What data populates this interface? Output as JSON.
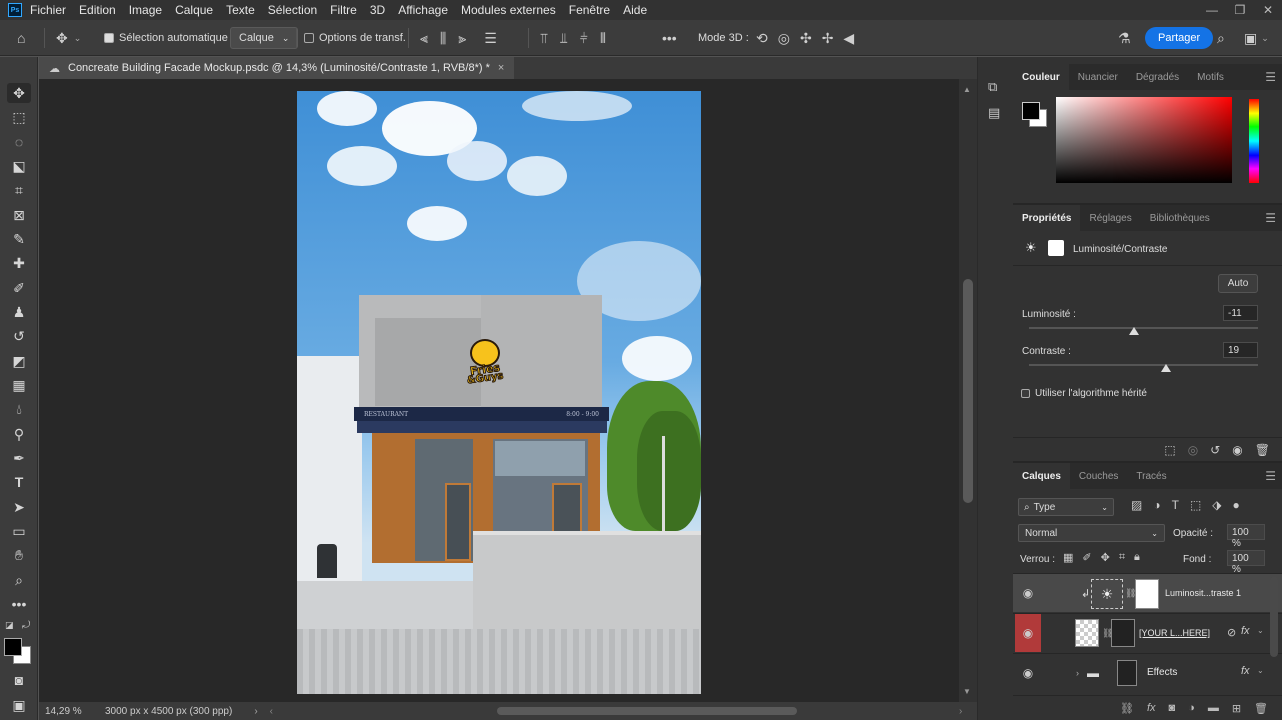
{
  "app": {
    "logo": "Ps",
    "menu": [
      "Fichier",
      "Edition",
      "Image",
      "Calque",
      "Texte",
      "Sélection",
      "Filtre",
      "3D",
      "Affichage",
      "Modules externes",
      "Fenêtre",
      "Aide"
    ]
  },
  "options": {
    "auto_select_label": "Sélection automatique :",
    "auto_select_value": "Calque",
    "transform_label": "Options de transf.",
    "mode3d_label": "Mode 3D :",
    "share_label": "Partager"
  },
  "document": {
    "tab_title": "Concreate Building Facade Mockup.psdc @ 14,3% (Luminosité/Contraste 1, RVB/8*) *",
    "close": "×",
    "sign_text_left": "RESTAURANT",
    "sign_text_right": "8:00 - 9:00",
    "logo_top": "Fries",
    "logo_bottom": "&Guys"
  },
  "status": {
    "zoom": "14,29 %",
    "size": "3000 px x 4500 px (300 ppp)"
  },
  "color_panel": {
    "tabs": [
      "Couleur",
      "Nuancier",
      "Dégradés",
      "Motifs"
    ],
    "fg": "#000000",
    "bg": "#ffffff"
  },
  "properties_panel": {
    "tabs": [
      "Propriétés",
      "Réglages",
      "Bibliothèques"
    ],
    "layer_type": "Luminosité/Contraste",
    "auto_label": "Auto",
    "brightness_label": "Luminosité :",
    "brightness_value": "-11",
    "brightness_level": 0.46,
    "contrast_label": "Contraste :",
    "contrast_value": "19",
    "contrast_level": 0.6,
    "legacy_label": "Utiliser l'algorithme hérité"
  },
  "layers_panel": {
    "tabs": [
      "Calques",
      "Couches",
      "Tracés"
    ],
    "filter_label": "Type",
    "blend_mode": "Normal",
    "opacity_label": "Opacité :",
    "opacity_value": "100 %",
    "lock_label": "Verrou :",
    "fill_label": "Fond :",
    "fill_value": "100 %",
    "layers": [
      {
        "name": "Luminosit...traste 1"
      },
      {
        "name": "[YOUR L...HERE]",
        "fx": "fx"
      },
      {
        "name": "Effects",
        "fx": "fx"
      }
    ]
  }
}
